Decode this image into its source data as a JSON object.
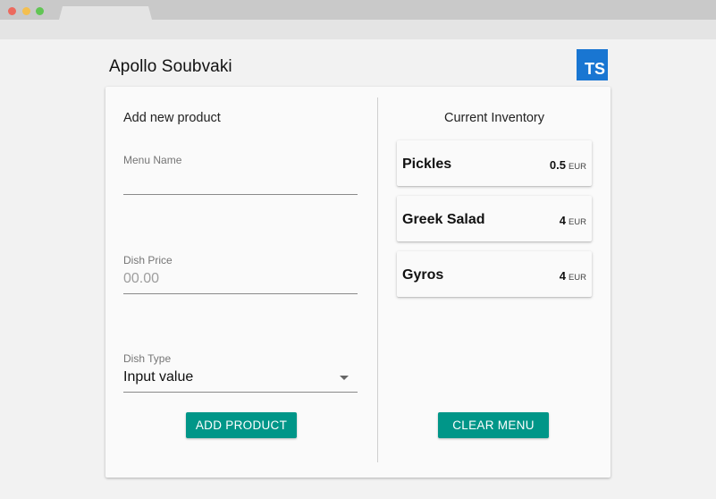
{
  "app": {
    "title": "Apollo Soubvaki",
    "logo_text": "TS",
    "logo_color": "#1976d2"
  },
  "form": {
    "heading": "Add new product",
    "menu_name": {
      "label": "Menu Name",
      "value": ""
    },
    "dish_price": {
      "label": "Dish Price",
      "placeholder": "00.00"
    },
    "dish_type": {
      "label": "Dish Type",
      "value": "Input value"
    },
    "add_button": "ADD PRODUCT"
  },
  "inventory": {
    "heading": "Current Inventory",
    "items": [
      {
        "name": "Pickles",
        "price": "0.5",
        "currency": "EUR"
      },
      {
        "name": "Greek Salad",
        "price": "4",
        "currency": "EUR"
      },
      {
        "name": "Gyros",
        "price": "4",
        "currency": "EUR"
      }
    ],
    "clear_button": "CLEAR MENU"
  },
  "colors": {
    "accent": "#009688",
    "background": "#f2f2f2",
    "card": "#fafafa"
  }
}
